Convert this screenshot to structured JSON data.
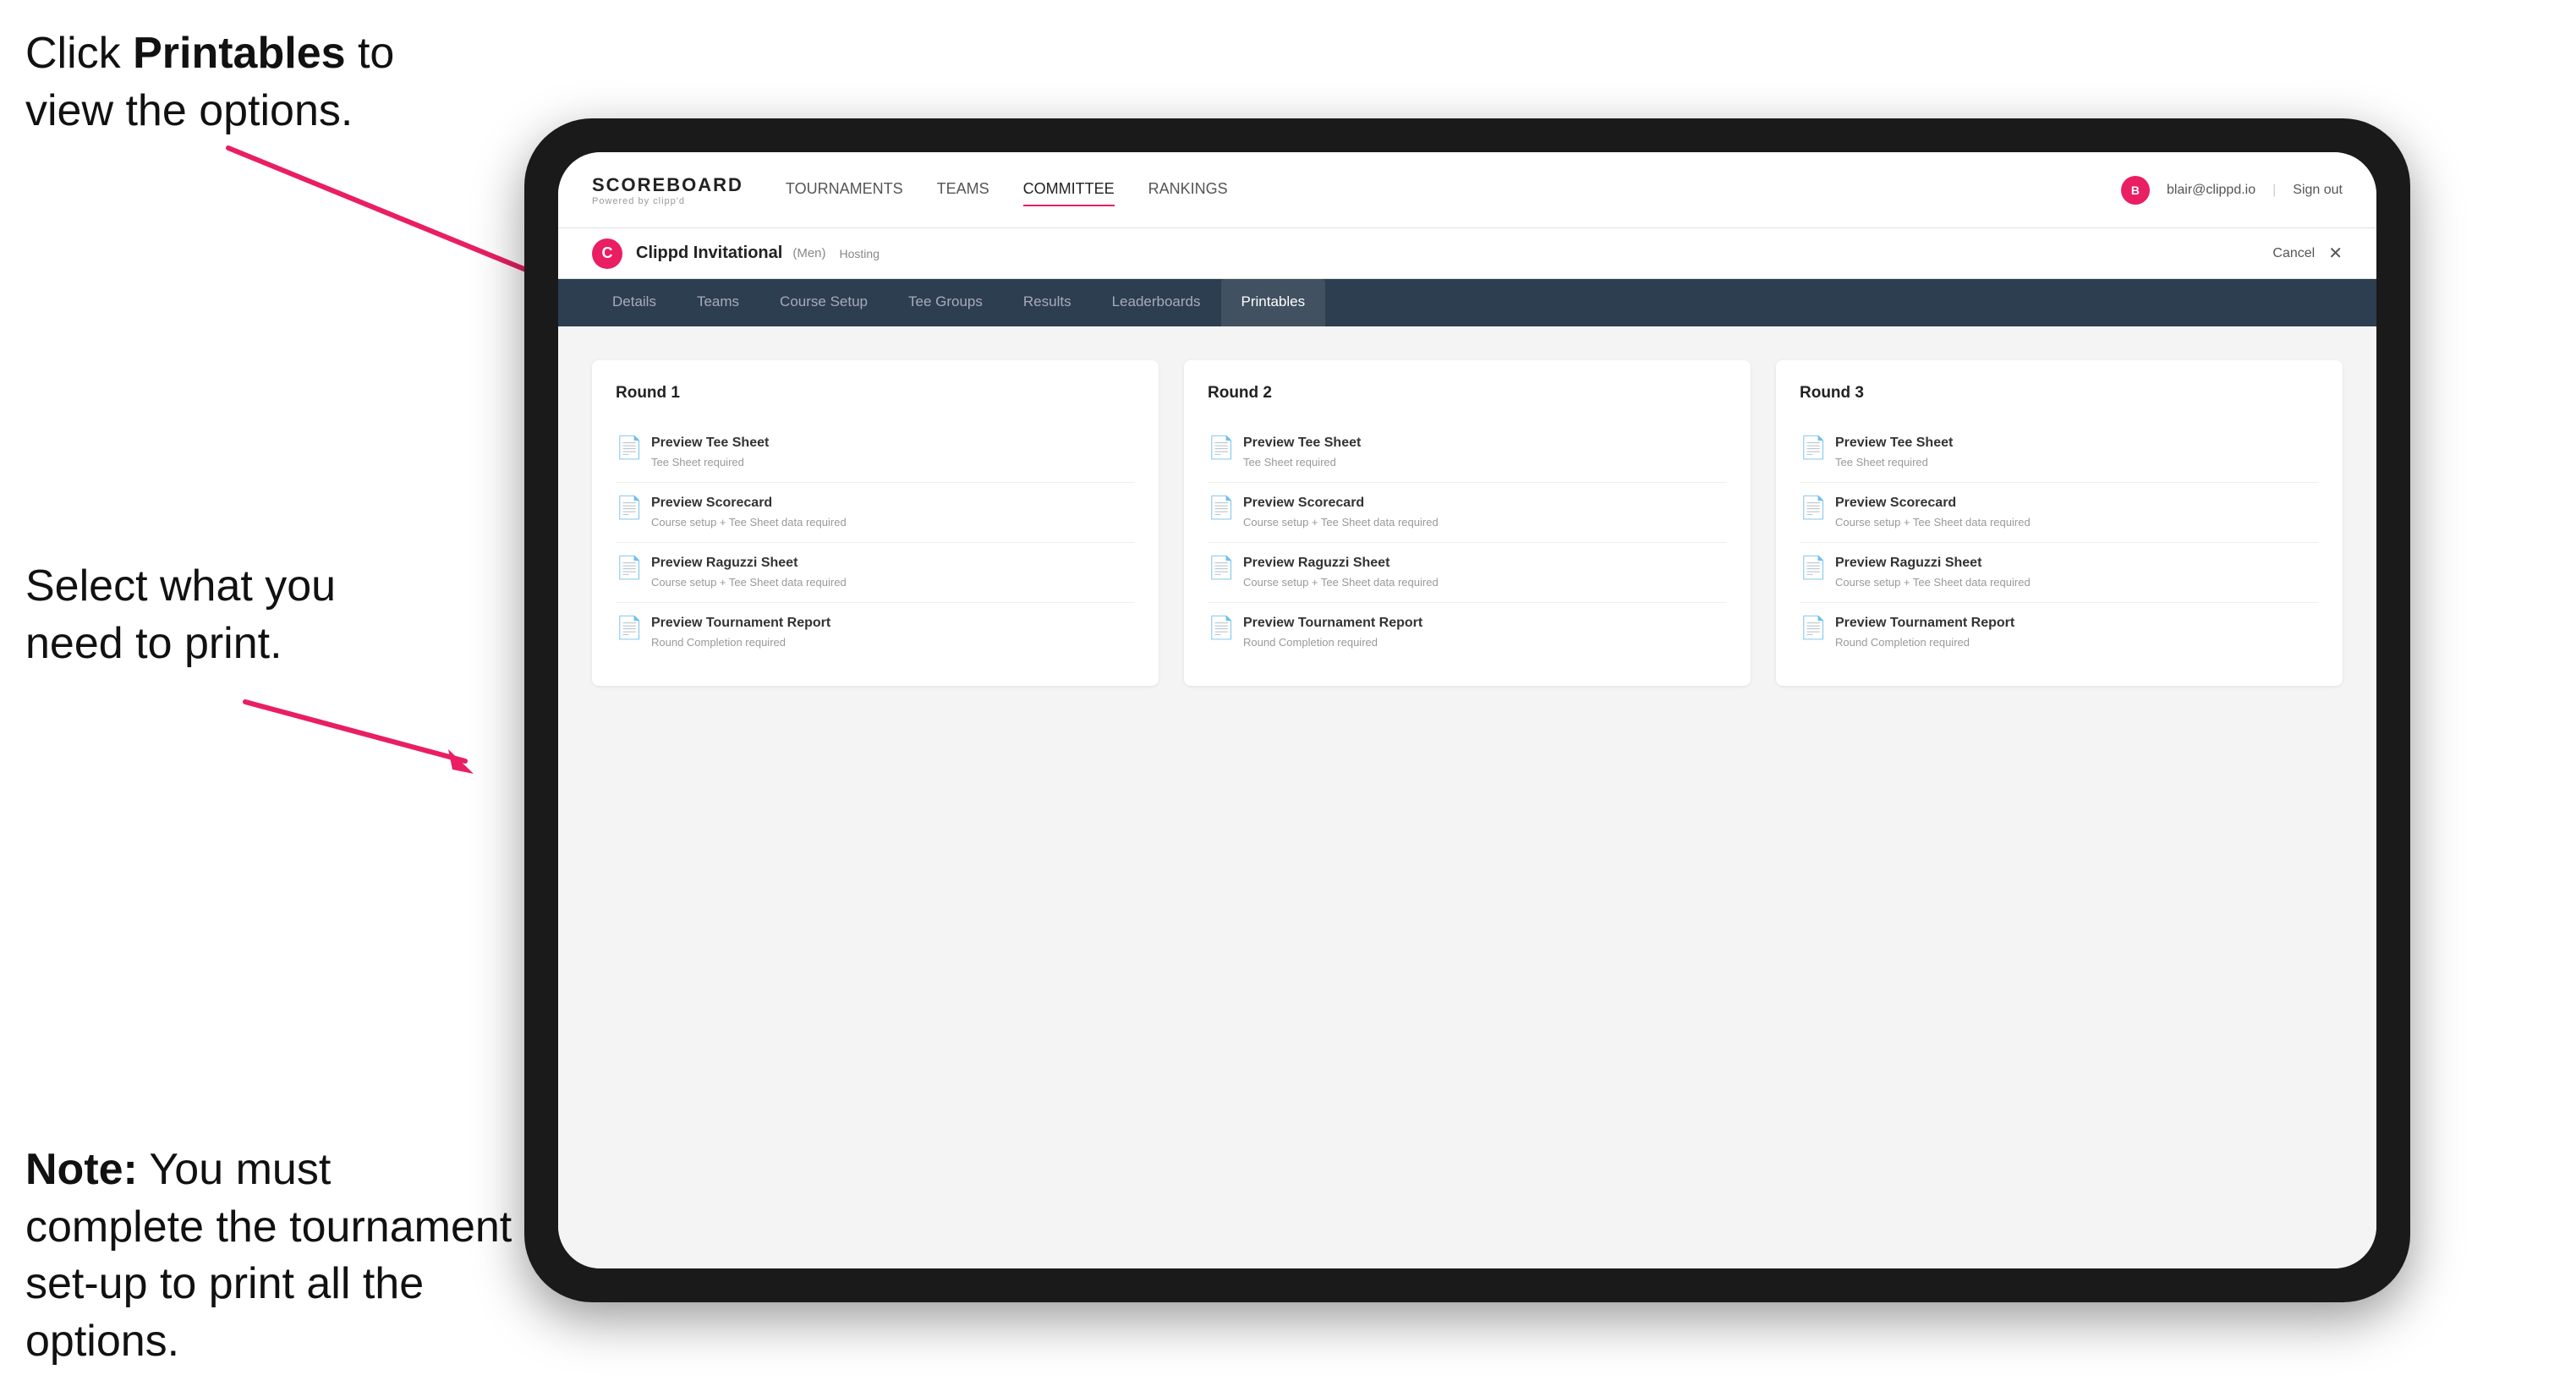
{
  "annotations": {
    "top_line1": "Click ",
    "top_bold": "Printables",
    "top_line2": " to",
    "top_line3": "view the options.",
    "middle_line1": "Select what you",
    "middle_line2": "need to print.",
    "bottom_note_bold": "Note:",
    "bottom_note_text": " You must complete the tournament set-up to print all the options."
  },
  "nav": {
    "brand_title": "SCOREBOARD",
    "brand_sub": "Powered by clipp'd",
    "links": [
      {
        "label": "TOURNAMENTS",
        "active": false
      },
      {
        "label": "TEAMS",
        "active": false
      },
      {
        "label": "COMMITTEE",
        "active": false
      },
      {
        "label": "RANKINGS",
        "active": false
      }
    ],
    "user_email": "blair@clippd.io",
    "sign_out": "Sign out",
    "separator": "|"
  },
  "sub_header": {
    "tournament_logo_letter": "C",
    "tournament_name": "Clippd Invitational",
    "tournament_tag": "(Men)",
    "hosting": "Hosting",
    "cancel": "Cancel",
    "close": "✕"
  },
  "tabs": [
    {
      "label": "Details",
      "active": false
    },
    {
      "label": "Teams",
      "active": false
    },
    {
      "label": "Course Setup",
      "active": false
    },
    {
      "label": "Tee Groups",
      "active": false
    },
    {
      "label": "Results",
      "active": false
    },
    {
      "label": "Leaderboards",
      "active": false
    },
    {
      "label": "Printables",
      "active": true
    }
  ],
  "rounds": [
    {
      "title": "Round 1",
      "items": [
        {
          "title": "Preview Tee Sheet",
          "subtitle": "Tee Sheet required"
        },
        {
          "title": "Preview Scorecard",
          "subtitle": "Course setup + Tee Sheet data required"
        },
        {
          "title": "Preview Raguzzi Sheet",
          "subtitle": "Course setup + Tee Sheet data required"
        },
        {
          "title": "Preview Tournament Report",
          "subtitle": "Round Completion required"
        }
      ]
    },
    {
      "title": "Round 2",
      "items": [
        {
          "title": "Preview Tee Sheet",
          "subtitle": "Tee Sheet required"
        },
        {
          "title": "Preview Scorecard",
          "subtitle": "Course setup + Tee Sheet data required"
        },
        {
          "title": "Preview Raguzzi Sheet",
          "subtitle": "Course setup + Tee Sheet data required"
        },
        {
          "title": "Preview Tournament Report",
          "subtitle": "Round Completion required"
        }
      ]
    },
    {
      "title": "Round 3",
      "items": [
        {
          "title": "Preview Tee Sheet",
          "subtitle": "Tee Sheet required"
        },
        {
          "title": "Preview Scorecard",
          "subtitle": "Course setup + Tee Sheet data required"
        },
        {
          "title": "Preview Raguzzi Sheet",
          "subtitle": "Course setup + Tee Sheet data required"
        },
        {
          "title": "Preview Tournament Report",
          "subtitle": "Round Completion required"
        }
      ]
    }
  ]
}
